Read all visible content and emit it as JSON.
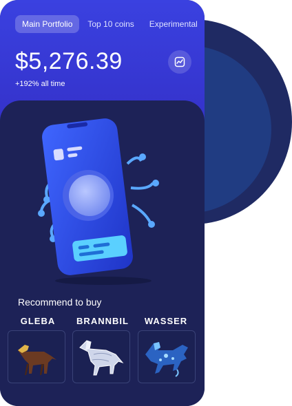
{
  "header": {
    "tabs": [
      {
        "label": "Main Portfolio",
        "active": true
      },
      {
        "label": "Top 10 coins",
        "active": false
      },
      {
        "label": "Experimental",
        "active": false
      }
    ],
    "balance": "$5,276.39",
    "change": "+192% all time",
    "chart_icon": "chart-line-icon"
  },
  "recommend": {
    "title": "Recommend to buy",
    "items": [
      {
        "label": "GLEBA",
        "icon": "brown-horse-icon"
      },
      {
        "label": "BRANNBIL",
        "icon": "glass-horse-icon"
      },
      {
        "label": "WASSER",
        "icon": "blue-water-horse-icon"
      }
    ]
  },
  "colors": {
    "header": "#3a41e0",
    "content": "#1d2257",
    "accent": "#5b8cff"
  }
}
